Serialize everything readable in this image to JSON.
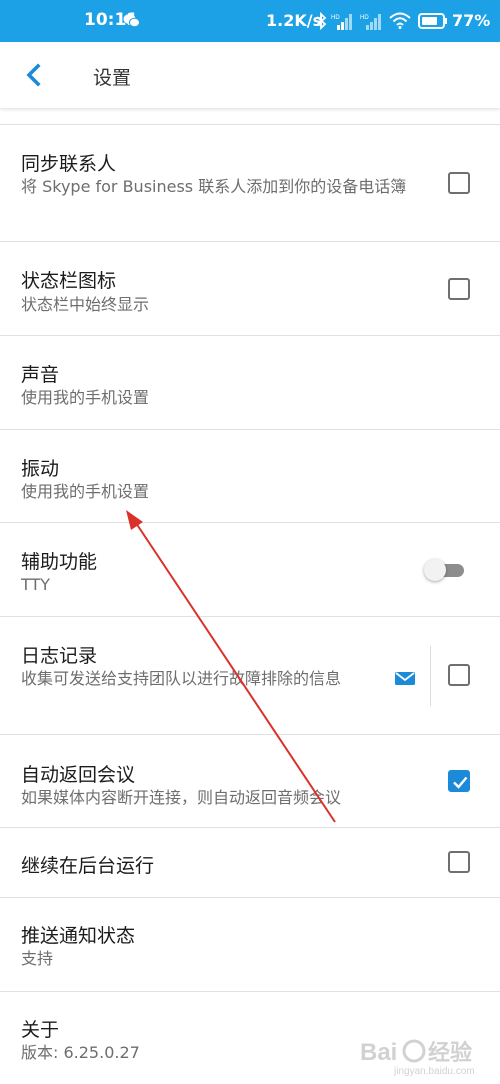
{
  "status_bar": {
    "time": "10:11",
    "network_speed": "1.2K/s",
    "battery": "77%",
    "icons": [
      "wechat-icon",
      "bluetooth-icon",
      "signal-icon",
      "signal-icon",
      "wifi-icon",
      "battery-icon"
    ],
    "background": "#1da1e6"
  },
  "app_bar": {
    "title": "设置",
    "back_icon": "chevron-left-icon",
    "accent": "#1b8ad8"
  },
  "settings": {
    "sync_contacts": {
      "title": "同步联系人",
      "subtitle": "将 Skype for Business 联系人添加到你的设备电话簿",
      "checked": false
    },
    "status_bar_icon": {
      "title": "状态栏图标",
      "subtitle": "状态栏中始终显示",
      "checked": false
    },
    "sound": {
      "title": "声音",
      "subtitle": "使用我的手机设置"
    },
    "vibration": {
      "title": "振动",
      "subtitle": "使用我的手机设置"
    },
    "accessibility": {
      "title": "辅助功能",
      "subtitle": "TTY",
      "toggle_on": false
    },
    "logging": {
      "title": "日志记录",
      "subtitle": "收集可发送给支持团队以进行故障排除的信息",
      "checked": false,
      "mail_icon": "mail-icon"
    },
    "auto_rejoin": {
      "title": "自动返回会议",
      "subtitle": "如果媒体内容断开连接，则自动返回音频会议",
      "checked": true
    },
    "run_in_background": {
      "title": "继续在后台运行",
      "checked": false
    },
    "push_status": {
      "title": "推送通知状态",
      "subtitle": "支持"
    },
    "about": {
      "title": "关于",
      "subtitle": "版本: 6.25.0.27"
    }
  },
  "annotation": {
    "color": "#d9322b"
  },
  "watermark": {
    "text": "Bai 经验",
    "url": "jingyan.baidu.com"
  }
}
